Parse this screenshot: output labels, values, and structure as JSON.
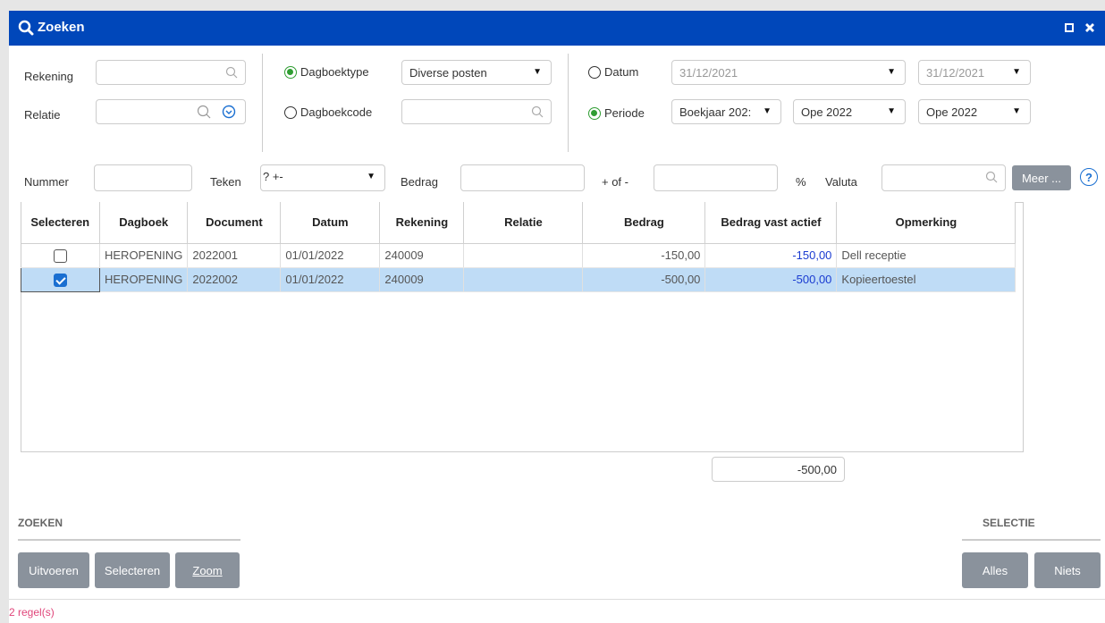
{
  "window": {
    "title": "Zoeken",
    "title_icon": "search-icon",
    "maximize_icon": "maximize-icon",
    "close_icon": "close-icon"
  },
  "filters": {
    "rekening_label": "Rekening",
    "relatie_label": "Relatie",
    "dagboektype_label": "Dagboektype",
    "dagboektype_value": "Diverse posten",
    "dagboekcode_label": "Dagboekcode",
    "datum_label": "Datum",
    "datum_from": "31/12/2021",
    "datum_to": "31/12/2021",
    "periode_label": "Periode",
    "periode_boekjaar": "Boekjaar 202:",
    "periode_from": "Ope 2022",
    "periode_to": "Ope 2022",
    "nummer_label": "Nummer",
    "teken_label": "Teken",
    "teken_value": "? +-",
    "bedrag_label": "Bedrag",
    "plusmin_label": "+ of -",
    "percent_label": "%",
    "valuta_label": "Valuta",
    "meer_label": "Meer ...",
    "help_label": "?"
  },
  "table": {
    "columns": [
      "Selecteren",
      "Dagboek",
      "Document",
      "Datum",
      "Rekening",
      "Relatie",
      "Bedrag",
      "Bedrag vast actief",
      "Opmerking"
    ],
    "rows": [
      {
        "checked": false,
        "dagboek": "HEROPENING",
        "document": "2022001",
        "datum": "01/01/2022",
        "rekening": "240009",
        "relatie": "",
        "bedrag": "-150,00",
        "bedrag_vast": "-150,00",
        "opmerking": "Dell receptie"
      },
      {
        "checked": true,
        "dagboek": "HEROPENING",
        "document": "2022002",
        "datum": "01/01/2022",
        "rekening": "240009",
        "relatie": "",
        "bedrag": "-500,00",
        "bedrag_vast": "-500,00",
        "opmerking": "Kopieertoestel"
      }
    ],
    "total": "-500,00"
  },
  "zoeken": {
    "header": "ZOEKEN",
    "uitvoeren": "Uitvoeren",
    "selecteren": "Selecteren",
    "zoom": "Zoom"
  },
  "selectie": {
    "header": "SELECTIE",
    "alles": "Alles",
    "niets": "Niets"
  },
  "status": "2 regel(s)",
  "colors": {
    "titlebar": "#0047ba",
    "selected_row": "#bfdcf6",
    "radio_on": "#2f9d32",
    "status_text": "#e0457a"
  }
}
